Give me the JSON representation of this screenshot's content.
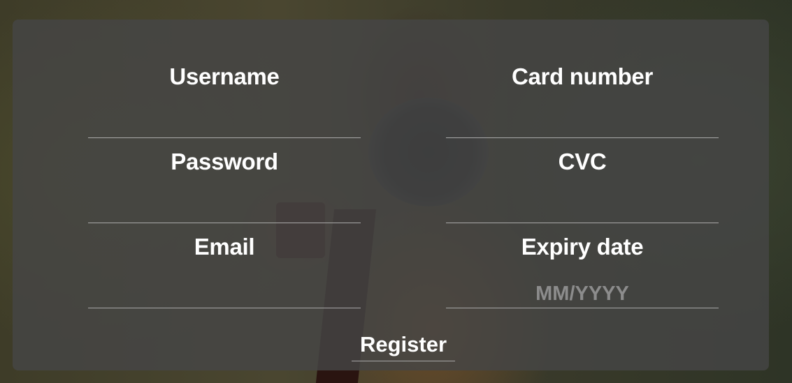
{
  "form": {
    "left_column": [
      {
        "label": "Username",
        "value": "",
        "placeholder": ""
      },
      {
        "label": "Password",
        "value": "",
        "placeholder": ""
      },
      {
        "label": "Email",
        "value": "",
        "placeholder": ""
      }
    ],
    "right_column": [
      {
        "label": "Card number",
        "value": "",
        "placeholder": ""
      },
      {
        "label": "CVC",
        "value": "",
        "placeholder": ""
      },
      {
        "label": "Expiry date",
        "value": "",
        "placeholder": "MM/YYYY"
      }
    ],
    "submit_label": "Register"
  },
  "colors": {
    "panel": "#464646",
    "text": "#ffffff",
    "placeholder": "#8c8c8c",
    "underline": "#a9a9a9"
  }
}
